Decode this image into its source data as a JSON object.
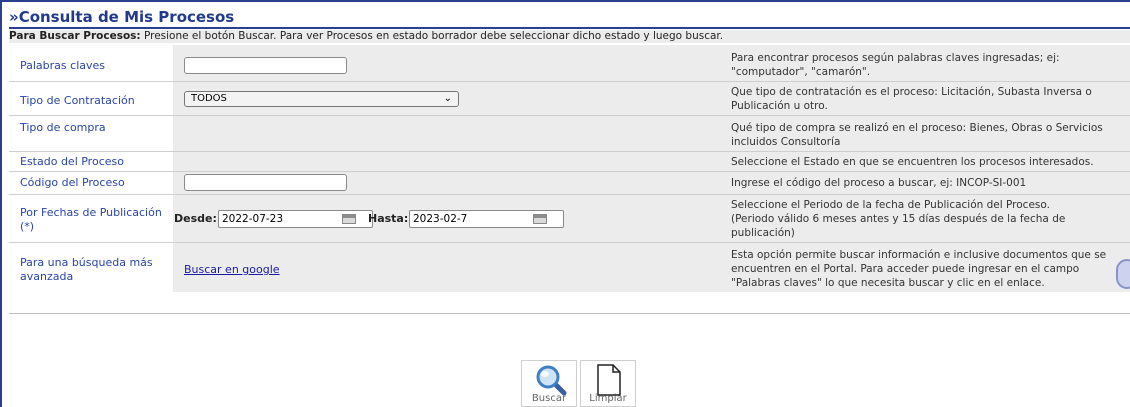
{
  "title": "»Consulta de Mis Procesos",
  "instructions": {
    "bold": "Para Buscar Procesos:",
    "text": " Presione el botón Buscar. Para ver Procesos en estado borrador debe seleccionar dicho estado y luego buscar."
  },
  "rows": {
    "keywords": {
      "label": "Palabras claves",
      "value": "",
      "help_l1": "Para encontrar procesos según palabras claves ingresadas; ej:",
      "help_l2": "\"computador\", \"camarón\"."
    },
    "contract_type": {
      "label": "Tipo de Contratación",
      "selected": "TODOS",
      "help_l1": "Que tipo de contratación es el proceso: Licitación, Subasta Inversa o",
      "help_l2": "Publicación u otro."
    },
    "purchase_type": {
      "label": "Tipo de compra",
      "help_l1": "Qué tipo de compra se realizó en el proceso: Bienes, Obras o Servicios",
      "help_l2": "incluidos Consultoría"
    },
    "status": {
      "label": "Estado del Proceso",
      "help_l1": "Seleccione el Estado en que se encuentren los procesos interesados."
    },
    "code": {
      "label": "Código del Proceso",
      "value": "",
      "help_l1": "Ingrese el código del proceso a buscar, ej: INCOP-SI-001"
    },
    "dates": {
      "label_l1": "Por Fechas de Publicación",
      "label_l2": "(*)",
      "from_label": "Desde:",
      "from_value": "2022-07-23",
      "to_label": "Hasta:",
      "to_value": "2023-02-7",
      "help_l1": "Seleccione el Periodo de la fecha de Publicación del Proceso.",
      "help_l2": "(Periodo válido 6 meses antes y 15 días después de la fecha de",
      "help_l3": "publicación)"
    },
    "advanced": {
      "label_l1": "Para una búsqueda más",
      "label_l2": "avanzada",
      "link": "Buscar en google",
      "help_l1": "Esta opción permite buscar información e inclusive documentos que se",
      "help_l2": "encuentren en el Portal. Para acceder puede ingresar en el campo",
      "help_l3": "\"Palabras claves\" lo que necesita buscar y clic en el enlace."
    }
  },
  "buttons": {
    "search": "Buscar",
    "clear": "Limpiar"
  },
  "icons": {
    "search": "magnifier-icon",
    "clear": "blank-document-icon",
    "calendar": "calendar-icon",
    "dropdown": "chevron-down-icon"
  }
}
